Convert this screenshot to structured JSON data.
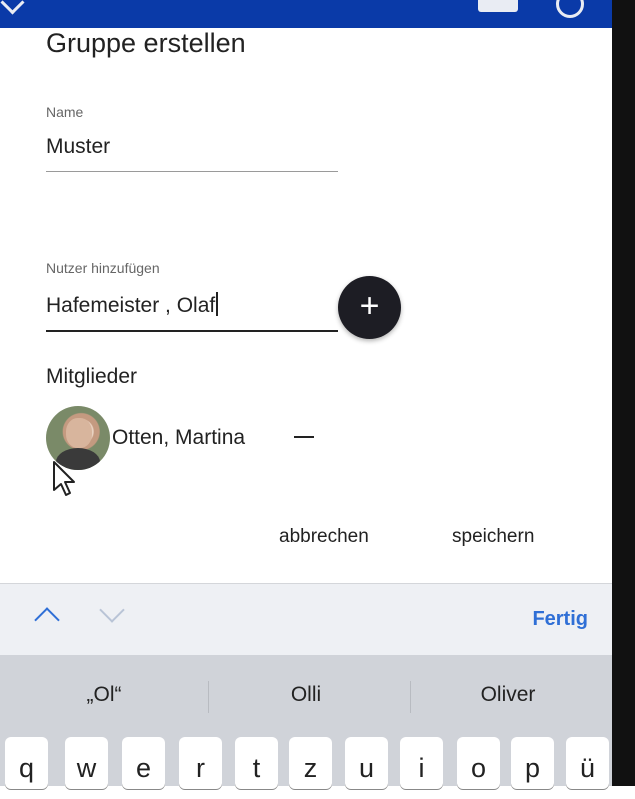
{
  "dialog": {
    "title": "Gruppe erstellen",
    "name_label": "Name",
    "name_value": "Muster",
    "user_label": "Nutzer hinzufügen",
    "user_value": "Hafemeister , Olaf",
    "add_icon": "plus-icon",
    "members_title": "Mitglieder",
    "members": [
      {
        "name": "Otten, Martina",
        "remove_icon": "minus-icon"
      }
    ],
    "cancel_label": "abbrechen",
    "save_label": "speichern"
  },
  "keyboard_toolbar": {
    "prev_icon": "chevron-up-icon",
    "next_icon": "chevron-down-icon",
    "done_label": "Fertig"
  },
  "suggestions": [
    "„Ol“",
    "Olli",
    "Oliver"
  ],
  "keys": [
    "q",
    "w",
    "e",
    "r",
    "t",
    "z",
    "u",
    "i",
    "o",
    "p",
    "ü"
  ],
  "colors": {
    "top_bar": "#0a3aa8",
    "accent": "#2f6fd6",
    "fab": "#1d1d24"
  }
}
